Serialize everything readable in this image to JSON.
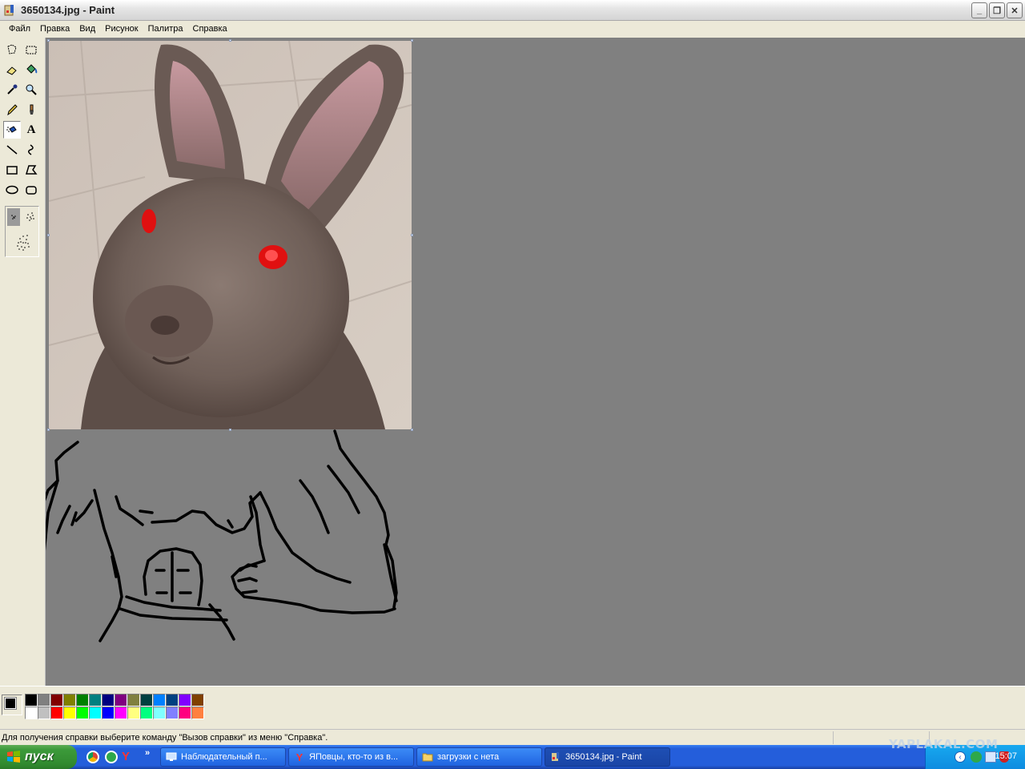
{
  "window": {
    "title": "3650134.jpg - Paint"
  },
  "menu": {
    "items": [
      "Файл",
      "Правка",
      "Вид",
      "Рисунок",
      "Палитра",
      "Справка"
    ]
  },
  "toolbox": {
    "tools": [
      "free-select",
      "rect-select",
      "eraser",
      "fill",
      "color-picker",
      "magnifier",
      "pencil",
      "brush",
      "airbrush",
      "text",
      "line",
      "curve",
      "rectangle",
      "polygon",
      "ellipse",
      "rounded-rectangle"
    ],
    "active": "airbrush"
  },
  "palette": {
    "foreground": "#000000",
    "background": "#ffffff",
    "colors": [
      "#000000",
      "#808080",
      "#800000",
      "#808000",
      "#008000",
      "#008080",
      "#000080",
      "#800080",
      "#808040",
      "#004040",
      "#0080ff",
      "#004080",
      "#8000ff",
      "#804000",
      "#ffffff",
      "#c0c0c0",
      "#ff0000",
      "#ffff00",
      "#00ff00",
      "#00ffff",
      "#0000ff",
      "#ff00ff",
      "#ffff80",
      "#00ff80",
      "#80ffff",
      "#8080ff",
      "#ff0080",
      "#ff8040"
    ]
  },
  "statusbar": {
    "text": "Для получения справки выберите команду \"Вызов справки\" из меню \"Справка\"."
  },
  "taskbar": {
    "start_label": "пуск",
    "tasks": [
      {
        "label": "Наблюдательный п...",
        "icon": "monitor-icon"
      },
      {
        "label": "ЯПовцы, кто-то из в...",
        "icon": "yandex-icon"
      },
      {
        "label": "загрузки с нета",
        "icon": "folder-icon"
      },
      {
        "label": "3650134.jpg - Paint",
        "icon": "paint-icon"
      }
    ],
    "clock": "15:07"
  },
  "watermark": "YAPLAKAL.COM"
}
